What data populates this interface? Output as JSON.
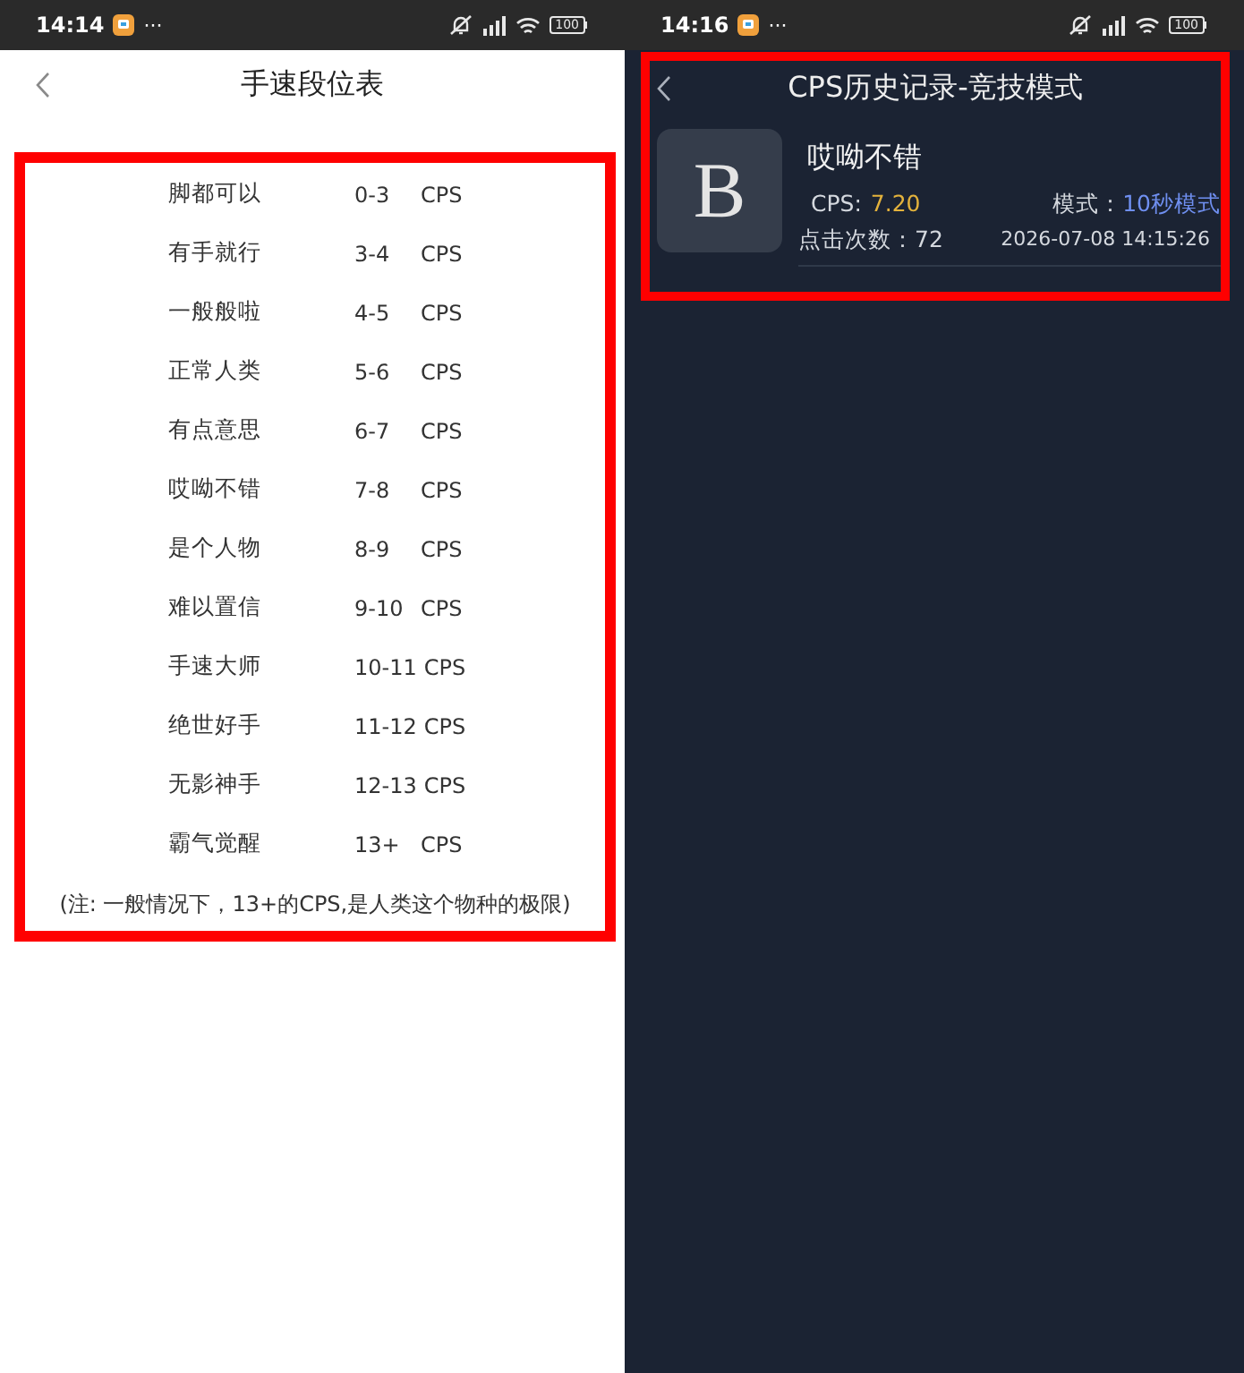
{
  "rank_screen": {
    "status_bar": {
      "time": "14:14",
      "more": "···",
      "battery": "100"
    },
    "header": {
      "title": "手速段位表"
    },
    "rank_table": {
      "rows": [
        {
          "name": "脚都可以",
          "range": "0-3",
          "unit": "CPS"
        },
        {
          "name": "有手就行",
          "range": "3-4",
          "unit": "CPS"
        },
        {
          "name": "一般般啦",
          "range": "4-5",
          "unit": "CPS"
        },
        {
          "name": "正常人类",
          "range": "5-6",
          "unit": "CPS"
        },
        {
          "name": "有点意思",
          "range": "6-7",
          "unit": "CPS"
        },
        {
          "name": "哎呦不错",
          "range": "7-8",
          "unit": "CPS"
        },
        {
          "name": "是个人物",
          "range": "8-9",
          "unit": "CPS"
        },
        {
          "name": "难以置信",
          "range": "9-10",
          "unit": "CPS"
        },
        {
          "name": "手速大师",
          "range": "10-11",
          "unit": "CPS"
        },
        {
          "name": "绝世好手",
          "range": "11-12",
          "unit": "CPS"
        },
        {
          "name": "无影神手",
          "range": "12-13",
          "unit": "CPS"
        },
        {
          "name": "霸气觉醒",
          "range": "13+",
          "unit": "CPS"
        }
      ],
      "note": "(注: 一般情况下，13+的CPS,是人类这个物种的极限)"
    }
  },
  "history_screen": {
    "status_bar": {
      "time": "14:16",
      "more": "···",
      "battery": "100"
    },
    "header": {
      "title": "CPS历史记录-竞技模式"
    },
    "records": [
      {
        "avatar_letter": "B",
        "title": "哎呦不错",
        "cps_label": "CPS:",
        "cps_value": "7.20",
        "mode_label": "模式：",
        "mode_value": "10秒模式",
        "clicks_label": "点击次数：",
        "clicks_value": "72",
        "time": "2026-07-08 14:15:26"
      }
    ]
  }
}
